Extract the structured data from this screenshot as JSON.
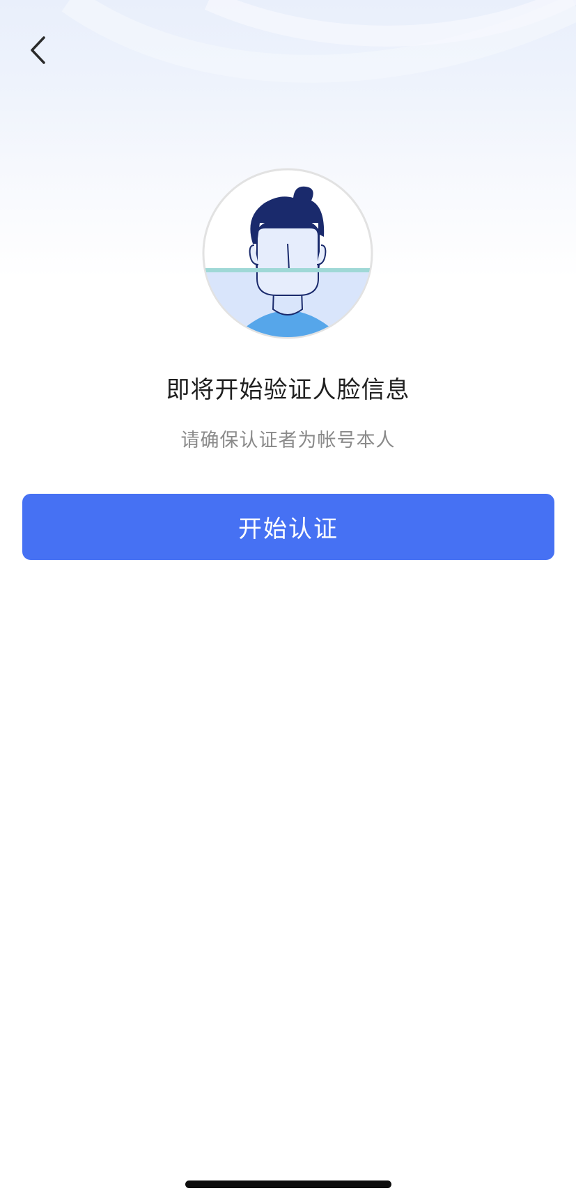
{
  "nav": {
    "back_icon": "chevron-left-icon"
  },
  "illustration": {
    "icon": "face-scan-icon"
  },
  "content": {
    "title": "即将开始验证人脸信息",
    "subtitle": "请确保认证者为帐号本人"
  },
  "actions": {
    "start_label": "开始认证"
  },
  "colors": {
    "primary": "#4671f3",
    "face_dark": "#1a2a6c",
    "scan_line": "#9fd8d6",
    "circle_fill": "#d9e5fb",
    "shirt": "#56a6ea"
  }
}
